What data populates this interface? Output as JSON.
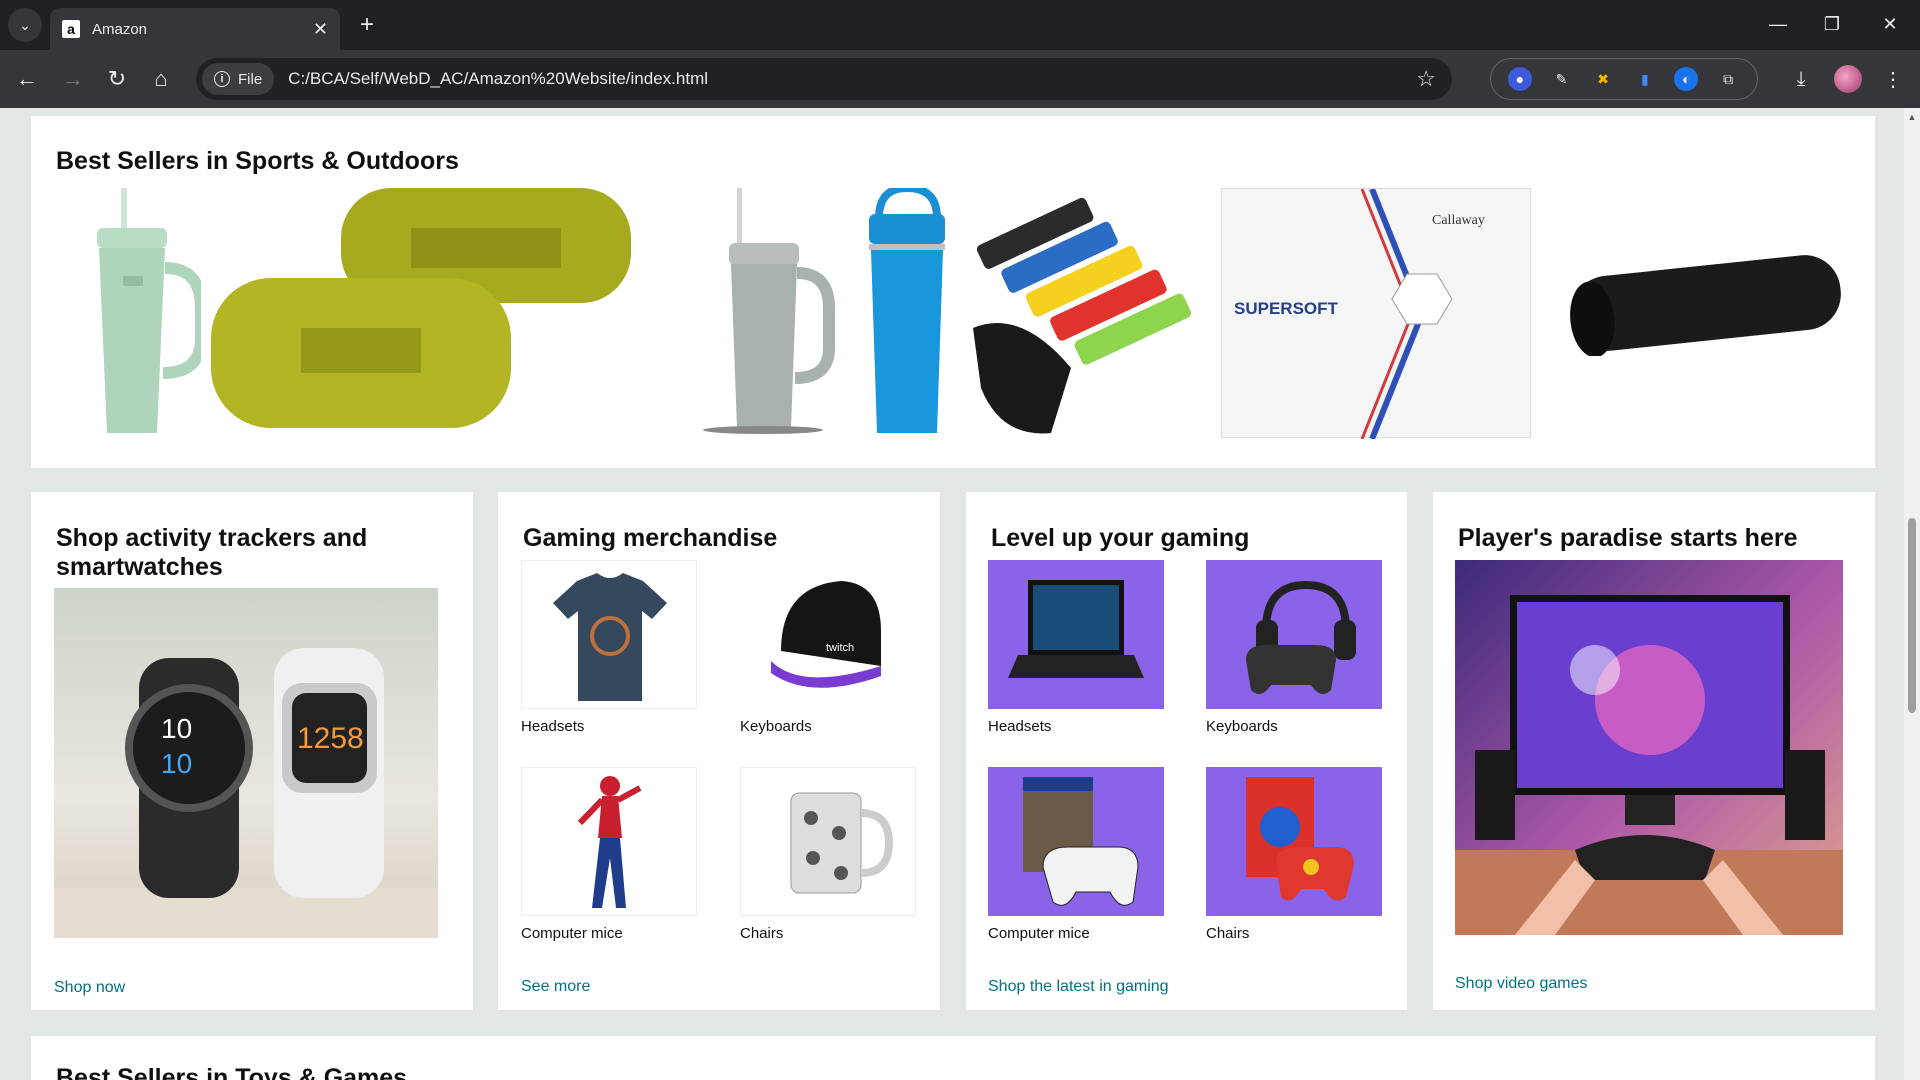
{
  "browser": {
    "tab_title": "Amazon",
    "url_chip": "File",
    "url": "C:/BCA/Self/WebD_AC/Amazon%20Website/index.html"
  },
  "best_sellers_sports": {
    "title": "Best Sellers in Sports & Outdoors"
  },
  "cards": {
    "trackers": {
      "title": "Shop activity trackers and smartwatches",
      "link": "Shop now"
    },
    "merch": {
      "title": "Gaming merchandise",
      "items": [
        "Headsets",
        "Keyboards",
        "Computer mice",
        "Chairs"
      ],
      "link": "See more"
    },
    "levelup": {
      "title": "Level up your gaming",
      "items": [
        "Headsets",
        "Keyboards",
        "Computer mice",
        "Chairs"
      ],
      "link": "Shop the latest in gaming"
    },
    "paradise": {
      "title": "Player's paradise starts here",
      "link": "Shop video games"
    }
  },
  "next_section": {
    "title": "Best Sellers in Toys & Games"
  }
}
